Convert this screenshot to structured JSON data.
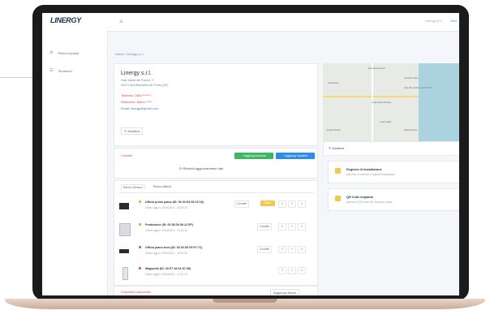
{
  "topbar": {
    "logo": "LINERGY",
    "menu_icon": "≡",
    "user": "Linergy S.r.l.",
    "logout": "Esci"
  },
  "sidebar": {
    "items": [
      {
        "icon": "⚙",
        "label": "Rilievi impianti"
      },
      {
        "icon": "☰",
        "label": "Strumenti"
      }
    ]
  },
  "breadcrumb": "Home / Linergy s.r.l.",
  "company": {
    "name": "Linergy s.r.l.",
    "address_line1": "Viale Martiri del Popolo, 9",
    "address_line2": "63074 San Benedetto del Tronto (AP)",
    "phone": "Telefono: 0861*******",
    "referent": "Referente: Mario *****",
    "email": "Email: linergy@gmail.com",
    "edit_label": "✎ Modifica"
  },
  "contacts": {
    "label": "Contatti",
    "btn_sensor": "+ Aggiungi sensore",
    "btn_plant": "+ Aggiungi Impianto",
    "refresh": "⟳ Richiedi aggiornamento dati"
  },
  "tabs": [
    "Elenco Sensori",
    "Elenco Allarmi"
  ],
  "devices": [
    {
      "title": "Ufficio primo piano (ID: 06 60 EA 69 15 18)",
      "sub": "Ultimo agg.to: 29/04/2021 - 15:26:15",
      "dot": "#f0a020",
      "connect": "Connetti",
      "tag": "Attivo"
    },
    {
      "title": "Produzione (ID: 06 58 D9 08 22 EF)",
      "sub": "Ultimo agg.to: 29/04/2021 - 15:26:10",
      "dot": "#f0a020",
      "connect": "Connetti",
      "tag": ""
    },
    {
      "title": "Ufficio piano terra (ID: 06 60 D5 09 F2 7C)",
      "sub": "Ultimo agg.to: 29/04/2021 - 15:25:40",
      "dot": "#e04848",
      "connect": "Connetti",
      "tag": ""
    },
    {
      "title": "Magazzini (ID: 60 E7 48 64 4C 59)",
      "sub": "Ultimo agg.to: 29/04/2021 - 12:01:20",
      "dot": "#e04848",
      "connect": "",
      "tag": ""
    }
  ],
  "footer": {
    "label": "Dispositivi disponibili",
    "btn": "Aggiungi utente"
  },
  "map": {
    "labels": [
      "Monteprandone",
      "Castorano",
      "San Benedetto del Tronto",
      "Grottammare",
      "Acquaviva Picena",
      "Colonnella",
      "Martinsicuro",
      "Ascoli Piceno"
    ],
    "edit": "✎ Modifica"
  },
  "info_cards": [
    {
      "title": "Registro di Installazione",
      "sub": "pannello di controllo e registro installazioni"
    },
    {
      "title": "QR Code impianto",
      "sub": "genera un QR code per l'accesso rapido"
    }
  ]
}
